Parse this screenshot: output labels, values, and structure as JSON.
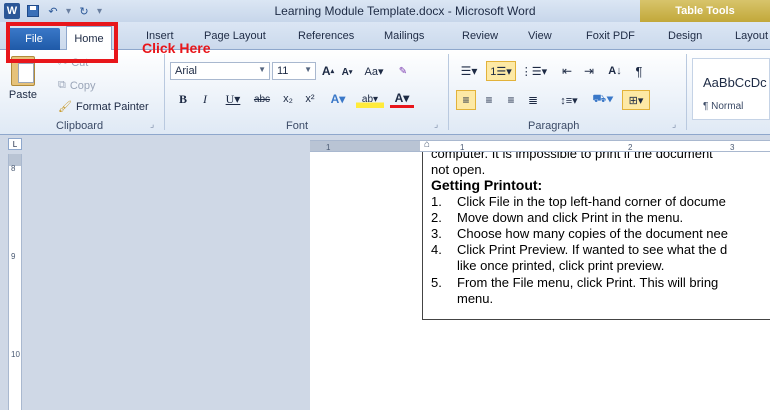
{
  "window": {
    "title": "Learning Module Template.docx - Microsoft Word",
    "contextual_tab": "Table Tools"
  },
  "tabs": {
    "file": "File",
    "home": "Home",
    "insert": "Insert",
    "page_layout": "Page Layout",
    "references": "References",
    "mailings": "Mailings",
    "review": "Review",
    "view": "View",
    "foxit": "Foxit PDF",
    "design": "Design",
    "layout": "Layout"
  },
  "annotation": {
    "click_here": "Click Here"
  },
  "clipboard": {
    "cut": "Cut",
    "copy": "Copy",
    "paste": "Paste",
    "format_painter": "Format Painter",
    "group_label": "Clipboard"
  },
  "font": {
    "name": "Arial",
    "size": "11",
    "group_label": "Font"
  },
  "paragraph": {
    "group_label": "Paragraph"
  },
  "styles": {
    "sample": "AaBbCcDc",
    "name": "¶ Normal"
  },
  "ruler": {
    "h_ticks": [
      "1",
      "1",
      "2",
      "3"
    ],
    "v_ticks": [
      "8",
      "9",
      "10"
    ]
  },
  "document": {
    "cut_line": "computer. It is impossible to print if the document",
    "line_not_open": "not open.",
    "heading": "Getting Printout:",
    "items": [
      {
        "num": "1.",
        "text": "Click File in the top left-hand corner of docume"
      },
      {
        "num": "2.",
        "text": "Move down and click Print in the menu."
      },
      {
        "num": "3.",
        "text": "Choose how many copies of the document nee"
      },
      {
        "num": "4.",
        "text": "Click Print Preview. If wanted to see what the d"
      },
      {
        "num": "",
        "text": "like once printed, click print preview."
      },
      {
        "num": "5.",
        "text": "From the File menu, click Print. This will bring"
      },
      {
        "num": "",
        "text": "menu."
      }
    ]
  },
  "colors": {
    "highlight": "#e8161b",
    "file_tab": "#1f5aa8",
    "table_tools": "#c2a83a"
  }
}
